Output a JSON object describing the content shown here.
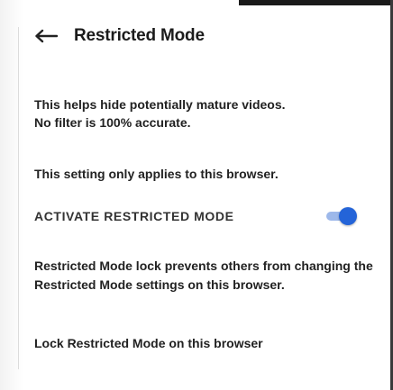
{
  "header": {
    "title": "Restricted Mode"
  },
  "body": {
    "description_line1": "This helps hide potentially mature videos.",
    "description_line2": "No filter is 100% accurate.",
    "browser_note": "This setting only applies to this browser.",
    "activate_label": "ACTIVATE RESTRICTED MODE",
    "lock_description": "Restricted Mode lock prevents others from changing the Restricted Mode settings on this browser.",
    "lock_link": "Lock Restricted Mode on this browser"
  },
  "toggle": {
    "state": "on",
    "accent_color": "#2464d8"
  },
  "icons": {
    "back": "arrow-left-icon"
  }
}
